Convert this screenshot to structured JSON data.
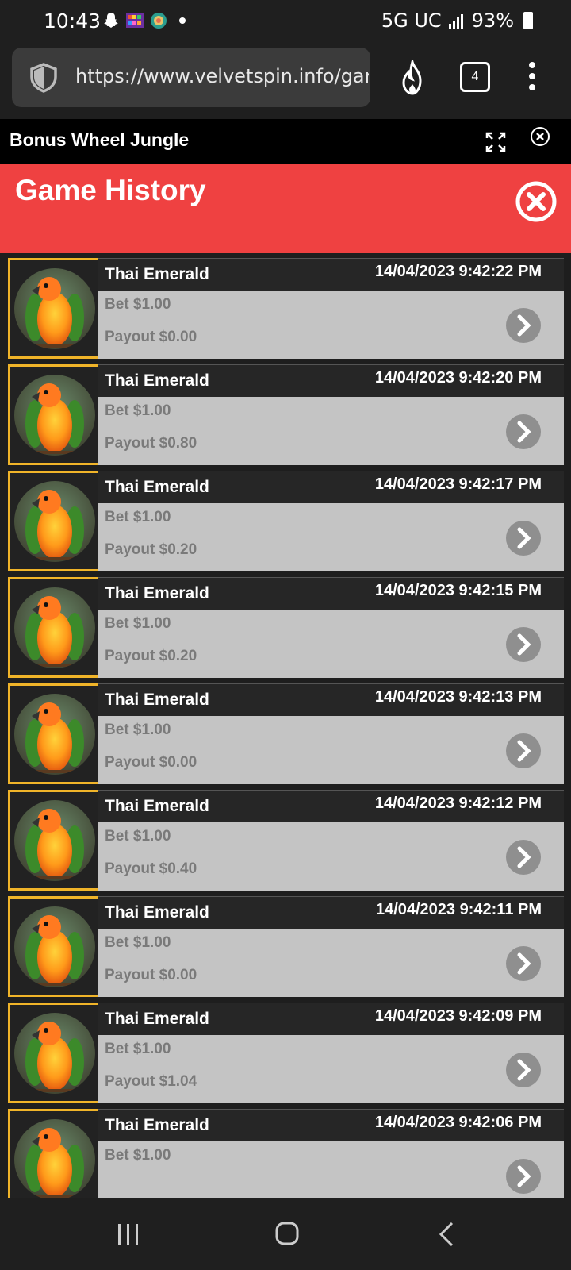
{
  "status_bar": {
    "time": "10:43",
    "network": "5G UC",
    "battery": "93%"
  },
  "browser": {
    "url": "https://www.velvetspin.info/gam",
    "tab_count": "4"
  },
  "game_header": {
    "title": "Bonus Wheel Jungle"
  },
  "history": {
    "title": "Game History",
    "rows": [
      {
        "game": "Thai Emerald",
        "time": "14/04/2023 9:42:22 PM",
        "bet": "Bet $1.00",
        "payout": "Payout $0.00"
      },
      {
        "game": "Thai Emerald",
        "time": "14/04/2023 9:42:20 PM",
        "bet": "Bet $1.00",
        "payout": "Payout $0.80"
      },
      {
        "game": "Thai Emerald",
        "time": "14/04/2023 9:42:17 PM",
        "bet": "Bet $1.00",
        "payout": "Payout $0.20"
      },
      {
        "game": "Thai Emerald",
        "time": "14/04/2023 9:42:15 PM",
        "bet": "Bet $1.00",
        "payout": "Payout $0.20"
      },
      {
        "game": "Thai Emerald",
        "time": "14/04/2023 9:42:13 PM",
        "bet": "Bet $1.00",
        "payout": "Payout $0.00"
      },
      {
        "game": "Thai Emerald",
        "time": "14/04/2023 9:42:12 PM",
        "bet": "Bet $1.00",
        "payout": "Payout $0.40"
      },
      {
        "game": "Thai Emerald",
        "time": "14/04/2023 9:42:11 PM",
        "bet": "Bet $1.00",
        "payout": "Payout $0.00"
      },
      {
        "game": "Thai Emerald",
        "time": "14/04/2023 9:42:09 PM",
        "bet": "Bet $1.00",
        "payout": "Payout $1.04"
      },
      {
        "game": "Thai Emerald",
        "time": "14/04/2023 9:42:06 PM",
        "bet": "Bet $1.00",
        "payout": ""
      }
    ]
  },
  "colors": {
    "header_red": "#ef4141",
    "thumb_border": "#f0b429",
    "row_body": "#c4c4c4"
  },
  "icons": {
    "status": [
      "snapchat-icon",
      "game-app-icon",
      "globe-app-icon",
      "dot-icon",
      "signal-icon",
      "battery-icon"
    ],
    "browser": [
      "shield-icon",
      "fire-icon",
      "tabs-icon",
      "more-menu-icon"
    ],
    "game": [
      "expand-icon",
      "close-icon"
    ],
    "row": [
      "parrot-thumbnail",
      "chevron-right-icon"
    ],
    "nav": [
      "recents-icon",
      "home-icon",
      "back-icon"
    ]
  }
}
